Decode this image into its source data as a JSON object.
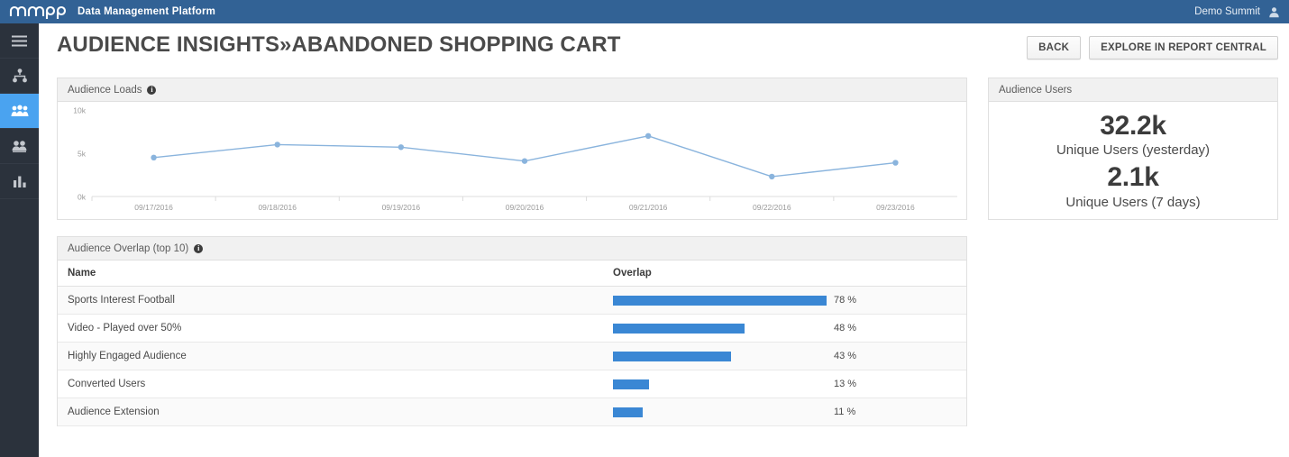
{
  "topbar": {
    "logo_text": "mapp",
    "product_title": "Data Management Platform",
    "user_name": "Demo Summit",
    "avatar_icon": "user-icon"
  },
  "sidebar": {
    "items": [
      {
        "icon": "hamburger-menu-icon",
        "active": false
      },
      {
        "icon": "sitemap-icon",
        "active": false
      },
      {
        "icon": "audience-group-icon",
        "active": true
      },
      {
        "icon": "users-icon",
        "active": false
      },
      {
        "icon": "bar-chart-icon",
        "active": false
      }
    ]
  },
  "page": {
    "title": "AUDIENCE INSIGHTS»ABANDONED SHOPPING CART",
    "back_button": "BACK",
    "explore_button": "EXPLORE IN REPORT CENTRAL"
  },
  "loads_panel": {
    "title": "Audience Loads",
    "info_icon": "info-icon"
  },
  "users_panel": {
    "title": "Audience Users",
    "metrics": [
      {
        "value": "32.2k",
        "label": "Unique Users (yesterday)"
      },
      {
        "value": "2.1k",
        "label": "Unique Users (7 days)"
      }
    ]
  },
  "overlap_panel": {
    "title": "Audience Overlap (top 10)",
    "info_icon": "info-icon",
    "columns": [
      "Name",
      "Overlap"
    ],
    "rows": [
      {
        "name": "Sports Interest Football",
        "pct": 78,
        "pct_label": "78 %"
      },
      {
        "name": "Video - Played over 50%",
        "pct": 48,
        "pct_label": "48 %"
      },
      {
        "name": "Highly Engaged Audience",
        "pct": 43,
        "pct_label": "43 %"
      },
      {
        "name": "Converted Users",
        "pct": 13,
        "pct_label": "13 %"
      },
      {
        "name": "Audience Extension",
        "pct": 11,
        "pct_label": "11 %"
      }
    ]
  },
  "colors": {
    "brand_blue": "#326295",
    "sidebar_dark": "#2b323c",
    "accent_blue": "#4aa3f0",
    "bar_blue": "#3a87d4",
    "line_blue": "#8ab4dd"
  },
  "chart_data": {
    "type": "line",
    "title": "Audience Loads",
    "xlabel": "",
    "ylabel": "",
    "x": [
      "09/17/2016",
      "09/18/2016",
      "09/19/2016",
      "09/20/2016",
      "09/21/2016",
      "09/22/2016",
      "09/23/2016"
    ],
    "series": [
      {
        "name": "Audience Loads",
        "values": [
          4500,
          6000,
          5700,
          4100,
          7000,
          2300,
          3900
        ]
      }
    ],
    "ylim": [
      0,
      10000
    ],
    "yticks": [
      0,
      5000,
      10000
    ],
    "ytick_labels": [
      "0k",
      "5k",
      "10k"
    ],
    "grid": false,
    "legend": "none",
    "marker": "circle",
    "line_color": "#8ab4dd"
  }
}
